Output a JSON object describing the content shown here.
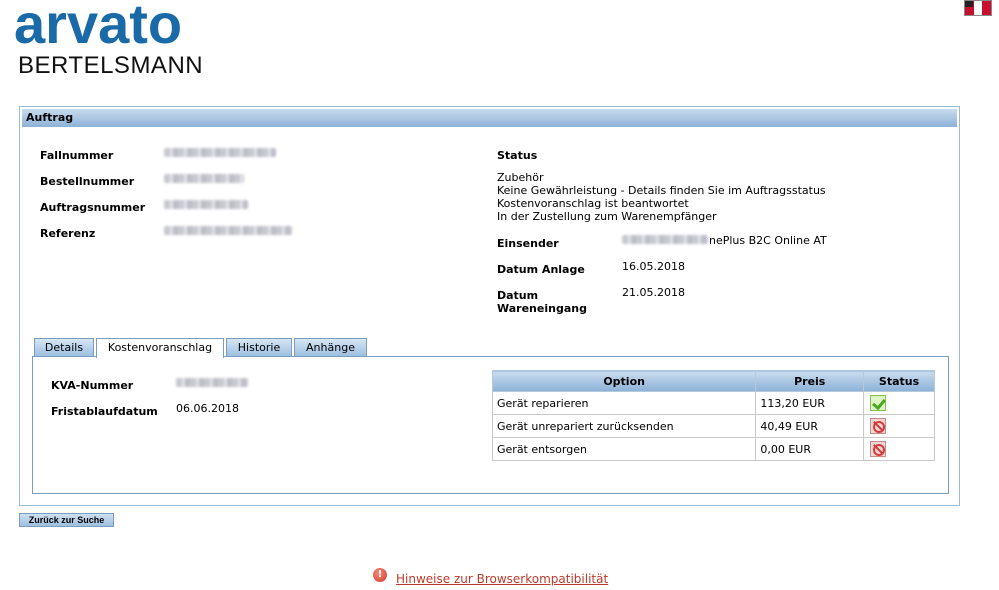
{
  "brand": {
    "name": "arvato",
    "sub": "BERTELSMANN"
  },
  "panel": {
    "title": "Auftrag"
  },
  "order": {
    "fallnummer_label": "Fallnummer",
    "bestellnummer_label": "Bestellnummer",
    "auftragsnummer_label": "Auftragsnummer",
    "referenz_label": "Referenz"
  },
  "status": {
    "label": "Status",
    "lines": [
      "Zubehör",
      "Keine Gewährleistung - Details finden Sie im Auftragsstatus",
      "Kostenvoranschlag ist beantwortet",
      "In der Zustellung zum Warenempfänger"
    ],
    "einsender_label": "Einsender",
    "einsender_value": "nePlus B2C Online AT",
    "datum_anlage_label": "Datum Anlage",
    "datum_anlage_value": "16.05.2018",
    "datum_wareneingang_label_1": "Datum",
    "datum_wareneingang_label_2": "Wareneingang",
    "datum_wareneingang_value": "21.05.2018"
  },
  "tabs": [
    {
      "label": "Details",
      "active": false
    },
    {
      "label": "Kostenvoranschlag",
      "active": true
    },
    {
      "label": "Historie",
      "active": false
    },
    {
      "label": "Anhänge",
      "active": false
    }
  ],
  "kva": {
    "nummer_label": "KVA-Nummer",
    "frist_label": "Fristablaufdatum",
    "frist_value": "06.06.2018"
  },
  "options_table": {
    "headers": [
      "Option",
      "Preis",
      "Status"
    ],
    "rows": [
      {
        "option": "Gerät reparieren",
        "price": "113,20 EUR",
        "status_icon": "check-icon"
      },
      {
        "option": "Gerät unrepariert zurücksenden",
        "price": "40,49 EUR",
        "status_icon": "forbidden-icon"
      },
      {
        "option": "Gerät entsorgen",
        "price": "0,00 EUR",
        "status_icon": "forbidden-icon"
      }
    ]
  },
  "footer": {
    "back_button": "Zurück zur Suche",
    "compat_link": "Hinweise zur Browserkompatibilität"
  },
  "colors": {
    "brand_blue": "#1a6aa8",
    "header_blue": "#8cb1d7",
    "link_red": "#c0392b"
  }
}
